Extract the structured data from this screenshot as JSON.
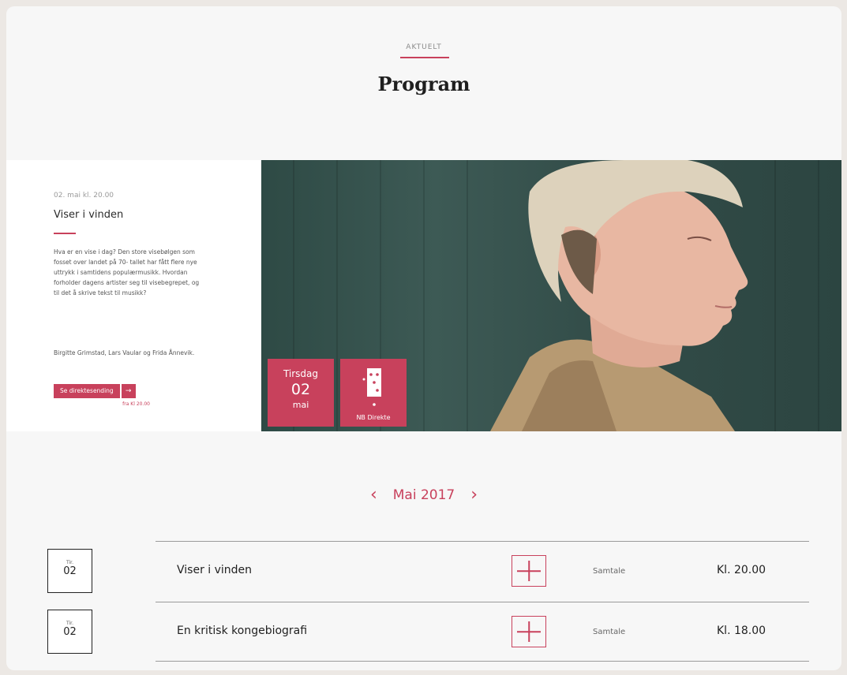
{
  "header": {
    "kicker": "AKTUELT",
    "title": "Program"
  },
  "featured": {
    "date_time": "02. mai kl. 20.00",
    "title": "Viser i vinden",
    "description": "Hva er en vise i dag? Den store visebølgen som fosset over landet på 70- tallet har fått flere nye uttrykk i samtidens populærmusikk. Hvordan forholder dagens artister seg til visebegrepet, og til det å skrive tekst til musikk?",
    "participants": "Birgitte Grimstad, Lars Vaular og Frida Ånnevik.",
    "live_button_label": "Se direktesending",
    "live_button_arrow": "→",
    "live_time": "fra Kl 20.00",
    "date_tile": {
      "weekday": "Tirsdag",
      "day": "02",
      "month": "mai"
    },
    "live_tile": {
      "label": "NB Direkte"
    }
  },
  "month_nav": {
    "prev_icon": "‹",
    "label": "Mai 2017",
    "next_icon": "›"
  },
  "events": [
    {
      "weekday": "Tir.",
      "day": "02",
      "title": "Viser i vinden",
      "category": "Samtale",
      "time": "Kl. 20.00"
    },
    {
      "weekday": "Tir.",
      "day": "02",
      "title": "En kritisk kongebiografi",
      "category": "Samtale",
      "time": "Kl. 18.00"
    }
  ],
  "colors": {
    "accent": "#c8415c",
    "background": "#f7f7f7"
  }
}
